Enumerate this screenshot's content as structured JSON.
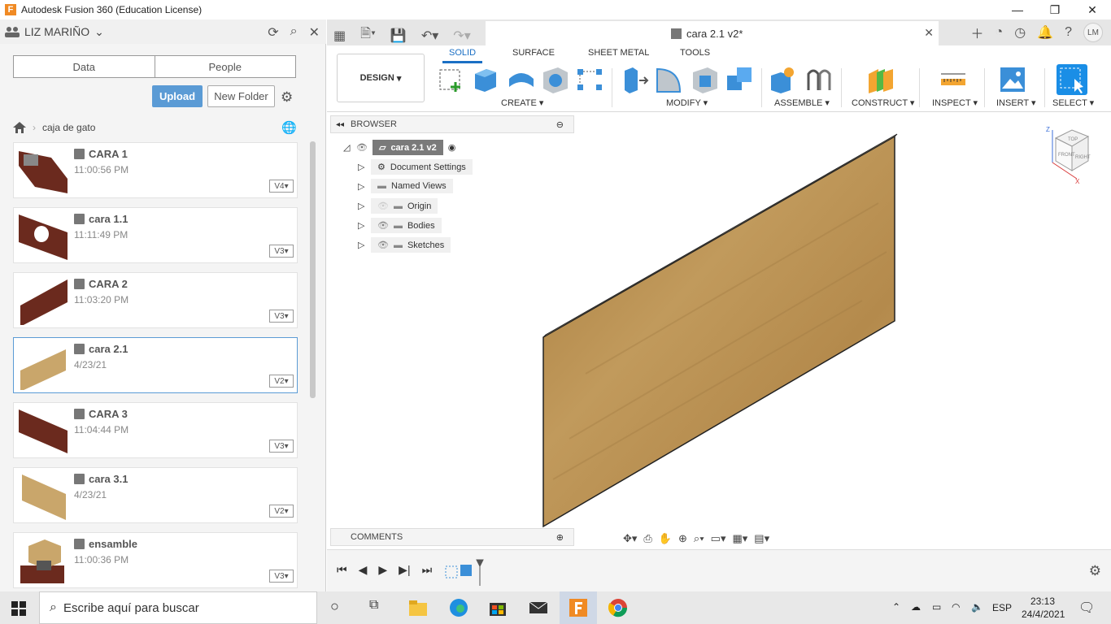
{
  "window": {
    "title": "Autodesk Fusion 360 (Education License)",
    "minimize": "—",
    "maximize": "❐",
    "close": "✕"
  },
  "left_panel": {
    "user": "LIZ MARIÑO",
    "tabs": [
      "Data",
      "People"
    ],
    "upload": "Upload",
    "new_folder": "New Folder",
    "breadcrumb": "caja de gato",
    "files": [
      {
        "name": "CARA 1",
        "time": "11:00:56 PM",
        "version": "V4"
      },
      {
        "name": "cara 1.1",
        "time": "11:11:49 PM",
        "version": "V3"
      },
      {
        "name": "CARA 2",
        "time": "11:03:20 PM",
        "version": "V3"
      },
      {
        "name": "cara 2.1",
        "time": "4/23/21",
        "version": "V2"
      },
      {
        "name": "CARA 3",
        "time": "11:04:44 PM",
        "version": "V3"
      },
      {
        "name": "cara 3.1",
        "time": "4/23/21",
        "version": "V2"
      },
      {
        "name": "ensamble",
        "time": "11:00:36 PM",
        "version": "V3"
      }
    ]
  },
  "doc_tab": {
    "title": "cara 2.1 v2*",
    "close": "✕"
  },
  "avatar": "LM",
  "ribbon": {
    "workspace": "DESIGN",
    "tabs": [
      "SOLID",
      "SURFACE",
      "SHEET METAL",
      "TOOLS"
    ],
    "groups": [
      "CREATE",
      "MODIFY",
      "ASSEMBLE",
      "CONSTRUCT",
      "INSPECT",
      "INSERT",
      "SELECT"
    ]
  },
  "browser": {
    "title": "BROWSER",
    "root": "cara 2.1 v2",
    "items": [
      "Document Settings",
      "Named Views",
      "Origin",
      "Bodies",
      "Sketches"
    ]
  },
  "comments": "COMMENTS",
  "viewcube": {
    "top": "TOP",
    "front": "FRONT",
    "right": "RIGHT",
    "z": "Z",
    "x": "X"
  },
  "taskbar": {
    "search_placeholder": "Escribe aquí para buscar",
    "lang": "ESP",
    "time": "23:13",
    "date": "24/4/2021"
  },
  "colors": {
    "accent": "#1a6fc4",
    "upload": "#5b9bd5",
    "wood": "#b38a4a"
  }
}
